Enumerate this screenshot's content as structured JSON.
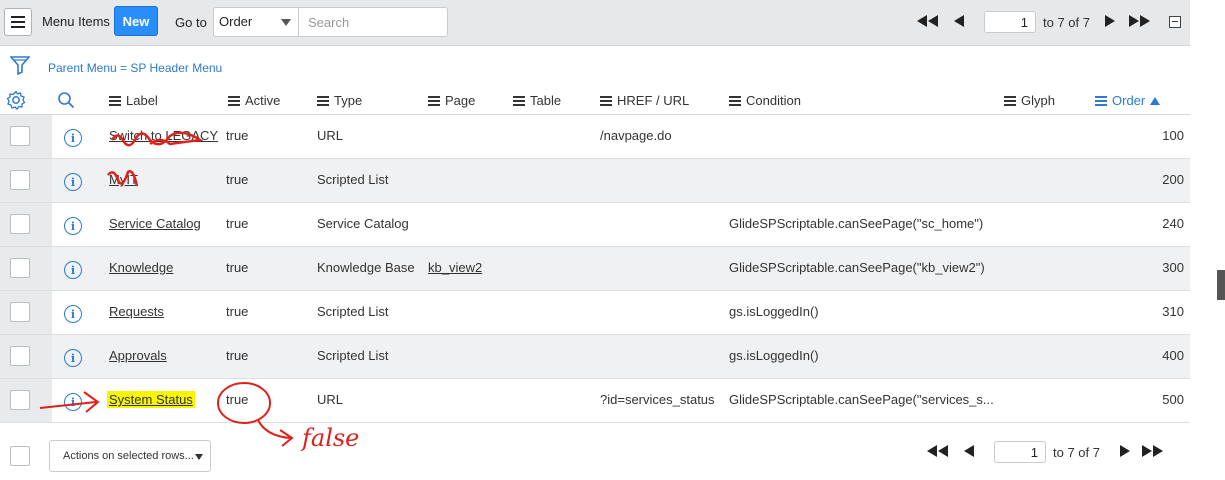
{
  "toolbar": {
    "title": "Menu Items",
    "new_label": "New",
    "goto_label": "Go to",
    "goto_select": "Order",
    "search_placeholder": "Search"
  },
  "pager": {
    "current": "1",
    "range_text": "to 7 of 7"
  },
  "filter": {
    "breadcrumb": "Parent Menu = SP Header Menu"
  },
  "columns": {
    "label": "Label",
    "active": "Active",
    "type": "Type",
    "page": "Page",
    "table": "Table",
    "href": "HREF / URL",
    "condition": "Condition",
    "glyph": "Glyph",
    "order": "Order"
  },
  "rows": [
    {
      "label": "Switch to LEGACY",
      "active": "true",
      "type": "URL",
      "page": "",
      "href": "/navpage.do",
      "condition": "",
      "order": "100"
    },
    {
      "label": "MyIT",
      "active": "true",
      "type": "Scripted List",
      "page": "",
      "href": "",
      "condition": "",
      "order": "200"
    },
    {
      "label": "Service Catalog",
      "active": "true",
      "type": "Service Catalog",
      "page": "",
      "href": "",
      "condition": "GlideSPScriptable.canSeePage(\"sc_home\")",
      "order": "240"
    },
    {
      "label": "Knowledge",
      "active": "true",
      "type": "Knowledge Base",
      "page": "kb_view2",
      "href": "",
      "condition": "GlideSPScriptable.canSeePage(\"kb_view2\")",
      "order": "300"
    },
    {
      "label": "Requests",
      "active": "true",
      "type": "Scripted List",
      "page": "",
      "href": "",
      "condition": "gs.isLoggedIn()",
      "order": "310"
    },
    {
      "label": "Approvals",
      "active": "true",
      "type": "Scripted List",
      "page": "",
      "href": "",
      "condition": "gs.isLoggedIn()",
      "order": "400"
    },
    {
      "label": "System Status",
      "active": "true",
      "type": "URL",
      "page": "",
      "href": "?id=services_status",
      "condition": "GlideSPScriptable.canSeePage(\"services_s...",
      "order": "500"
    }
  ],
  "footer": {
    "actions_label": "Actions on selected rows...",
    "current": "1",
    "range_text": "to 7 of 7"
  },
  "annotations": {
    "handwritten_note": "false",
    "marker_color": "#e0201b",
    "highlight_color": "#f7f500"
  },
  "icons": [
    "hamburger-icon",
    "first-page-icon",
    "prev-page-icon",
    "next-page-icon",
    "last-page-icon",
    "collapse-icon",
    "filter-icon",
    "gear-icon",
    "search-icon",
    "info-icon",
    "caret-down-icon"
  ]
}
